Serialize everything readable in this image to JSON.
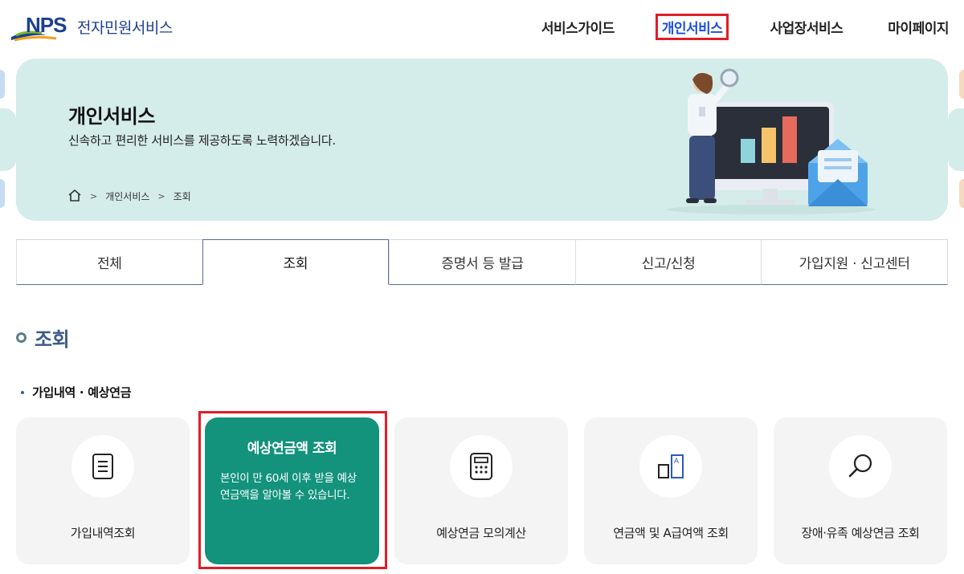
{
  "header": {
    "logo_text": "NPS",
    "service_name": "전자민원서비스",
    "nav": [
      {
        "label": "서비스가이드"
      },
      {
        "label": "개인서비스"
      },
      {
        "label": "사업장서비스"
      },
      {
        "label": "마이페이지"
      }
    ]
  },
  "hero": {
    "title": "개인서비스",
    "subtitle": "신속하고 편리한 서비스를 제공하도록 노력하겠습니다.",
    "breadcrumb": [
      "개인서비스",
      "조회"
    ]
  },
  "tabs": [
    {
      "label": "전체"
    },
    {
      "label": "조회"
    },
    {
      "label": "증명서 등 발급"
    },
    {
      "label": "신고/신청"
    },
    {
      "label": "가입지원 · 신고센터"
    }
  ],
  "section": {
    "title": "조회",
    "subsection": "가입내역 · 예상연금"
  },
  "cards": [
    {
      "label": "가입내역조회",
      "icon": "document-icon"
    },
    {
      "title": "예상연금액 조회",
      "description": "본인이 만 60세 이후 받을 예상연금액을 알아볼 수 있습니다."
    },
    {
      "label": "예상연금 모의계산",
      "icon": "calculator-icon"
    },
    {
      "label": "연금액 및 A급여액 조회",
      "icon": "bar-a-icon"
    },
    {
      "label": "장애·유족 예상연금 조회",
      "icon": "magnifier-icon"
    }
  ],
  "colors": {
    "brand": "#1d3f8f",
    "hero_bg": "#d4ecea",
    "active_card": "#13927c",
    "highlight": "#e11d2a"
  }
}
